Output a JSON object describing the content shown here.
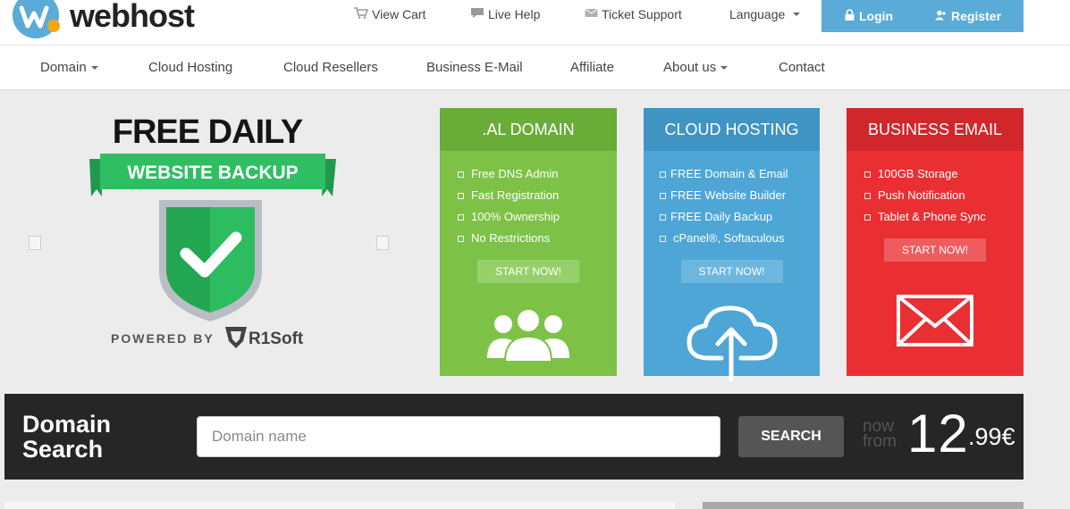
{
  "brand": {
    "name": "webhost",
    "accent": "#5aabd8"
  },
  "toplinks": [
    {
      "label": "View Cart",
      "icon": "cart-icon"
    },
    {
      "label": "Live Help",
      "icon": "chat-icon"
    },
    {
      "label": "Ticket Support",
      "icon": "ticket-icon"
    },
    {
      "label": "Language"
    }
  ],
  "auth": {
    "login": "Login",
    "register": "Register"
  },
  "nav": [
    "Domain",
    "Cloud Hosting",
    "Cloud Resellers",
    "Business E-Mail",
    "Affiliate",
    "About us",
    "Contact"
  ],
  "hero": {
    "line1": "FREE DAILY",
    "line2": "WEBSITE BACKUP",
    "powered": "POWERED BY",
    "partner": "R1Soft"
  },
  "cards": [
    {
      "title": ".AL DOMAIN",
      "features": [
        "Free DNS Admin",
        "Fast Registration",
        "100% Ownership",
        "No Restrictions"
      ],
      "button": "START NOW!",
      "color": "#7dc247",
      "head_color": "#6aac38",
      "btn_color": "#97d06a",
      "icon": "users-icon"
    },
    {
      "title": "CLOUD HOSTING",
      "features": [
        "FREE Domain & Email",
        "FREE Website Builder",
        "FREE Daily Backup",
        "cPanel®, Softaculous"
      ],
      "button": "START NOW!",
      "color": "#4ea6d6",
      "head_color": "#3f94c3",
      "btn_color": "#6db7df",
      "icon": "cloud-upload-icon"
    },
    {
      "title": "BUSINESS EMAIL",
      "features": [
        "100GB Storage",
        "Push Notification",
        "Tablet & Phone Sync"
      ],
      "button": "START NOW!",
      "color": "#ea2f33",
      "head_color": "#d1262a",
      "btn_color": "#ef5c5f",
      "icon": "envelope-icon"
    }
  ],
  "domain_search": {
    "title_line1": "Domain",
    "title_line2": "Search",
    "placeholder": "Domain name",
    "button": "SEARCH",
    "price_label_1": "now",
    "price_label_2": "from",
    "price_main": "12",
    "price_cents": ".99€"
  }
}
